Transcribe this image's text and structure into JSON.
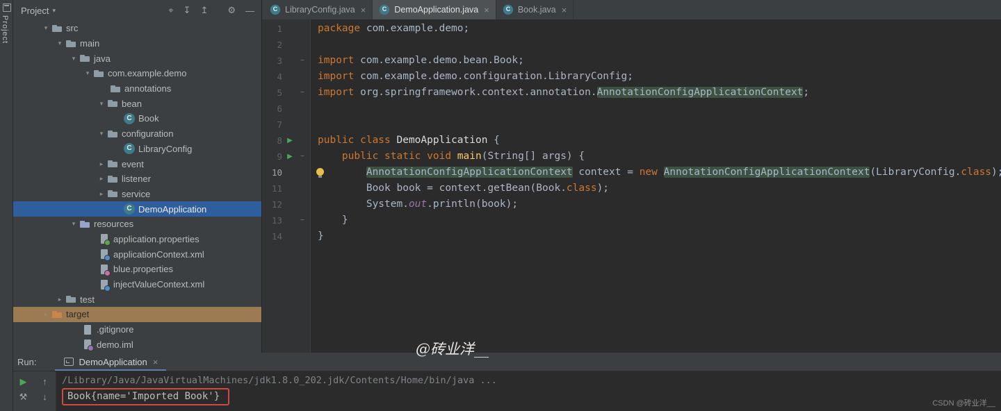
{
  "activity_bar": {
    "vertical_label": "Project"
  },
  "icon_glyphs": {
    "class": "C",
    "chevron_expanded": "▾",
    "chevron_collapsed": "▸",
    "run_arrow": "▶",
    "fold": "−",
    "nbsp": " "
  },
  "project_panel": {
    "title": "Project",
    "title_caret": "▾",
    "toolbar_icons": [
      {
        "name": "locate-file-icon",
        "glyph": "⌖"
      },
      {
        "name": "expand-all-icon",
        "glyph": "↧"
      },
      {
        "name": "collapse-all-icon",
        "glyph": "↥"
      },
      {
        "name": "settings-gear-icon",
        "glyph": "⚙"
      },
      {
        "name": "hide-panel-icon",
        "glyph": "—"
      }
    ],
    "tree": [
      {
        "label": "src",
        "indent": 40,
        "icon": "folder",
        "chevron": "expanded"
      },
      {
        "label": "main",
        "indent": 60,
        "icon": "folder",
        "chevron": "expanded"
      },
      {
        "label": "java",
        "indent": 80,
        "icon": "folder",
        "chevron": "expanded"
      },
      {
        "label": "com.example.demo",
        "indent": 100,
        "icon": "folder",
        "chevron": "expanded"
      },
      {
        "label": "annotations",
        "indent": 124,
        "icon": "folder",
        "chevron": "none"
      },
      {
        "label": "bean",
        "indent": 120,
        "icon": "folder",
        "chevron": "expanded"
      },
      {
        "label": "Book",
        "indent": 144,
        "icon": "class",
        "chevron": "none"
      },
      {
        "label": "configuration",
        "indent": 120,
        "icon": "folder",
        "chevron": "expanded"
      },
      {
        "label": "LibraryConfig",
        "indent": 144,
        "icon": "class",
        "chevron": "none"
      },
      {
        "label": "event",
        "indent": 120,
        "icon": "folder",
        "chevron": "collapsed"
      },
      {
        "label": "listener",
        "indent": 120,
        "icon": "folder",
        "chevron": "collapsed"
      },
      {
        "label": "service",
        "indent": 120,
        "icon": "folder",
        "chevron": "collapsed"
      },
      {
        "label": "DemoApplication",
        "indent": 144,
        "icon": "class",
        "chevron": "none",
        "selected": true
      },
      {
        "label": "resources",
        "indent": 80,
        "icon": "folder-res",
        "chevron": "expanded"
      },
      {
        "label": "application.properties",
        "indent": 108,
        "icon": "props",
        "chevron": "none"
      },
      {
        "label": "applicationContext.xml",
        "indent": 108,
        "icon": "xml",
        "chevron": "none"
      },
      {
        "label": "blue.properties",
        "indent": 108,
        "icon": "props2",
        "chevron": "none"
      },
      {
        "label": "injectValueContext.xml",
        "indent": 108,
        "icon": "xml",
        "chevron": "none"
      },
      {
        "label": "test",
        "indent": 60,
        "icon": "folder",
        "chevron": "collapsed"
      },
      {
        "label": "target",
        "indent": 40,
        "icon": "folder-excl",
        "chevron": "collapsed",
        "highlight": "tan"
      },
      {
        "label": ".gitignore",
        "indent": 84,
        "icon": "file",
        "chevron": "none"
      },
      {
        "label": "demo.iml",
        "indent": 84,
        "icon": "file-iml",
        "chevron": "none"
      }
    ]
  },
  "editor": {
    "tabs": [
      {
        "label": "LibraryConfig.java",
        "icon": "class",
        "active": false,
        "close": "×"
      },
      {
        "label": "DemoApplication.java",
        "icon": "class",
        "active": true,
        "close": "×"
      },
      {
        "label": "Book.java",
        "icon": "class",
        "active": false,
        "close": "×"
      }
    ],
    "code_lines": [
      {
        "n": 1,
        "seg": [
          [
            "k",
            "package"
          ],
          [
            "p",
            " com.example.demo;"
          ]
        ]
      },
      {
        "n": 2,
        "seg": []
      },
      {
        "n": 3,
        "fold": true,
        "seg": [
          [
            "k",
            "import"
          ],
          [
            "p",
            " com.example.demo.bean.Book;"
          ]
        ]
      },
      {
        "n": 4,
        "seg": [
          [
            "k",
            "import"
          ],
          [
            "p",
            " com.example.demo.configuration.LibraryConfig;"
          ]
        ]
      },
      {
        "n": 5,
        "fold": true,
        "seg": [
          [
            "k",
            "import"
          ],
          [
            "p",
            " org.springframework.context.annotation."
          ],
          [
            "h",
            "AnnotationConfigApplicationContext"
          ],
          [
            "p",
            ";"
          ]
        ]
      },
      {
        "n": 6,
        "seg": []
      },
      {
        "n": 7,
        "seg": []
      },
      {
        "n": 8,
        "run": true,
        "seg": [
          [
            "k",
            "public class"
          ],
          [
            "w",
            " DemoApplication"
          ],
          [
            "p",
            " {"
          ]
        ]
      },
      {
        "n": 9,
        "run": true,
        "fold": true,
        "seg": [
          [
            "p",
            "    "
          ],
          [
            "k",
            "public static void"
          ],
          [
            "p",
            " "
          ],
          [
            "f",
            "main"
          ],
          [
            "p",
            "(String[] args) {"
          ]
        ]
      },
      {
        "n": 10,
        "caret": true,
        "bulb": true,
        "seg": [
          [
            "p",
            "        "
          ],
          [
            "h",
            "AnnotationConfigApplicationContext"
          ],
          [
            "p",
            " context = "
          ],
          [
            "k",
            "new"
          ],
          [
            "p",
            " "
          ],
          [
            "h",
            "AnnotationConfigApplicationContext"
          ],
          [
            "p",
            "(LibraryConfig."
          ],
          [
            "k",
            "class"
          ],
          [
            "p",
            ");"
          ]
        ]
      },
      {
        "n": 11,
        "seg": [
          [
            "p",
            "        Book book = context.getBean(Book."
          ],
          [
            "k",
            "class"
          ],
          [
            "p",
            ");"
          ]
        ]
      },
      {
        "n": 12,
        "seg": [
          [
            "p",
            "        System."
          ],
          [
            "o",
            "out"
          ],
          [
            "p",
            ".println(book);"
          ]
        ]
      },
      {
        "n": 13,
        "fold": true,
        "seg": [
          [
            "p",
            "    }"
          ]
        ]
      },
      {
        "n": 14,
        "seg": [
          [
            "p",
            "}"
          ]
        ]
      }
    ]
  },
  "run_panel": {
    "label": "Run:",
    "tab": {
      "label": "DemoApplication",
      "close": "×"
    },
    "toolbar_icons": [
      {
        "name": "rerun-icon",
        "glyph": "▶",
        "green": true
      },
      {
        "name": "step-up-icon",
        "glyph": "↑",
        "green": false
      },
      {
        "name": "settings-wrench-icon",
        "glyph": "⚒",
        "green": false
      },
      {
        "name": "step-down-icon",
        "glyph": "↓",
        "green": false
      }
    ],
    "console": [
      {
        "text": "/Library/Java/JavaVirtualMachines/jdk1.8.0_202.jdk/Contents/Home/bin/java ...",
        "style": "cmd",
        "boxed": false
      },
      {
        "text": "Book{name='Imported Book'}",
        "style": "out",
        "boxed": true
      }
    ]
  },
  "watermarks": {
    "center": "@砖业洋__",
    "corner": "CSDN @砖业洋__"
  },
  "colors": {
    "selection_blue": "#2F5E9E",
    "excluded_tan": "#9C7B52",
    "keyword_orange": "#CC7832",
    "method_yellow": "#FFC66B",
    "field_purple": "#9876AA",
    "identifier_highlight": "#3E5244",
    "run_green": "#4FA65A",
    "error_box_red": "#D14A41",
    "panel_bg": "#3C3F41",
    "editor_bg": "#2B2B2B"
  }
}
